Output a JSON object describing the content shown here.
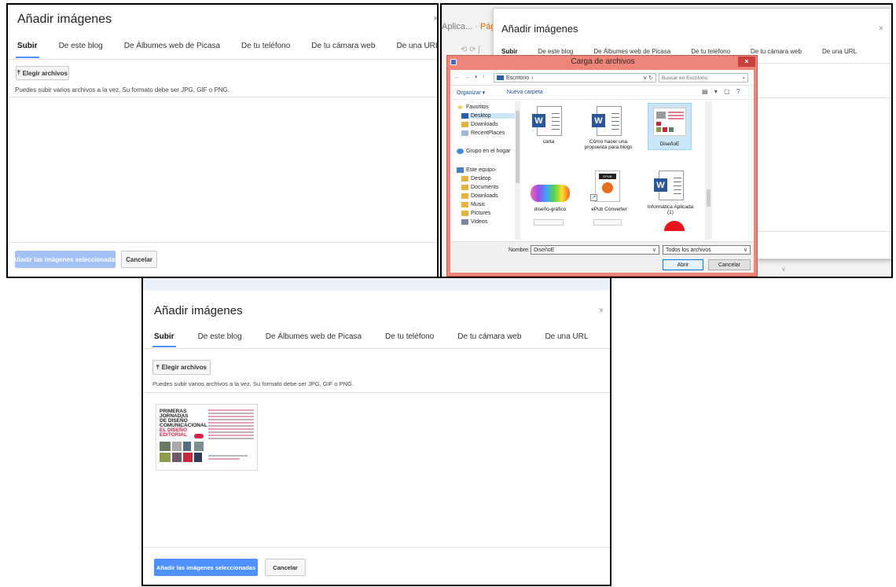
{
  "dialog": {
    "title": "Añadir imágenes",
    "close": "×",
    "tabs": [
      "Subir",
      "De este blog",
      "De Álbumes web de Picasa",
      "De tu teléfono",
      "De tu cámara web",
      "De una URL"
    ],
    "choose_button": "Elegir archivos",
    "upload_glyph": "⤒",
    "hint": "Puedes subir varios archivos a la vez. Su formato debe ser JPG, GIF o PNG.",
    "add_selected_button": "Añadir las imágenes seleccionadas",
    "cancel_button": "Cancelar"
  },
  "background_page": {
    "tab_prefix": "Aplica...",
    "tab_separator": "·",
    "tab_orange": "Págí",
    "nav_glyphs": "⟲ ⟳ ʃ"
  },
  "file_dialog": {
    "title": "Carga de archivos",
    "close": "×",
    "nav_glyphs": "← → ▾ ↑",
    "address_path": "Escritorio",
    "address_sep": "›",
    "address_tail": "∨ ↻",
    "search_placeholder": "Buscar en Escritorio",
    "search_glyph": "⌕",
    "toolbar": {
      "organize": "Organizar ▾",
      "new_folder": "Nueva carpeta",
      "view_glyphs": "▤ ▾ ▢",
      "help": "?"
    },
    "nav_tree": [
      {
        "label": "Favoritos",
        "icon": "star-icon"
      },
      {
        "label": "Desktop",
        "icon": "desktop-icon"
      },
      {
        "label": "Downloads",
        "icon": "downloads-icon"
      },
      {
        "label": "RecentPlaces",
        "icon": "recent-places-icon"
      },
      {
        "label": "Grupo en el hogar",
        "icon": "homegroup-icon"
      },
      {
        "label": "Este equipo",
        "icon": "computer-icon"
      },
      {
        "label": "Desktop",
        "icon": "desktop-icon"
      },
      {
        "label": "Documents",
        "icon": "documents-icon"
      },
      {
        "label": "Downloads",
        "icon": "downloads-icon"
      },
      {
        "label": "Music",
        "icon": "music-icon"
      },
      {
        "label": "Pictures",
        "icon": "pictures-icon"
      },
      {
        "label": "Videos",
        "icon": "videos-icon"
      }
    ],
    "files": [
      "carta",
      "Cómo hacer una propuesta para blogs",
      "DiseñoE",
      "diseño-gráfico",
      "ePub Converter",
      "Informática Aplicada (1)"
    ],
    "word_glyph": "W",
    "epub_badge": "EPUB",
    "shortcut_glyph": "↗",
    "name_label": "Nombre:",
    "name_value": "DiseñoE",
    "caret_glyph": "∨",
    "file_type": "Todos los archivos",
    "open_button": "Abrir",
    "cancel_button": "Cancelar"
  },
  "thumbnail": {
    "lines": [
      "PRIMERAS",
      "JORNADAS",
      "DE DISEÑO",
      "COMUNICACIONAL",
      "EL DISEÑO",
      "EDITORIAL"
    ]
  },
  "colors": {
    "accent_blue": "#4d90fe",
    "disabled_blue": "#a3c1f5",
    "window_frame": "#ef8578",
    "word_blue": "#2b579a",
    "thumb_red": "#d4234c"
  }
}
